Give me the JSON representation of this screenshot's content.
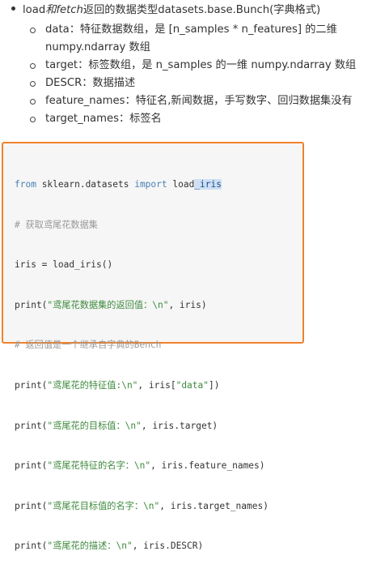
{
  "notes": {
    "top": {
      "prefix": "load",
      "italic": "和fetch",
      "suffix": "返回的数据类型datasets.base.Bunch(字典格式)"
    },
    "items": [
      "data：特征数据数组，是 [n_samples * n_features] 的二维",
      "numpy.ndarray 数组",
      "target：标签数组，是 n_samples 的一维 numpy.ndarray 数组",
      "DESCR：数据描述",
      "feature_names：特征名,新闻数据，手写数字、回归数据集没有",
      "target_names：标签名"
    ]
  },
  "code": {
    "l1_kw1": "from",
    "l1_mod": " sklearn.datasets ",
    "l1_kw2": "import",
    "l1_name_a": " load",
    "l1_name_sel": "_iris",
    "l2": "# 获取鸢尾花数据集",
    "l3": "iris = load_iris()",
    "l4_a": "print(",
    "l4_str": "\"鸢尾花数据集的返回值：\\n\"",
    "l4_b": ", iris)",
    "l5": "# 返回值是一个继承自字典的Bench",
    "l6_a": "print(",
    "l6_str": "\"鸢尾花的特征值:\\n\"",
    "l6_b": ", iris[",
    "l6_str2": "\"data\"",
    "l6_c": "])",
    "l7_a": "print(",
    "l7_str": "\"鸢尾花的目标值：\\n\"",
    "l7_b": ", iris.target)",
    "l8_a": "print(",
    "l8_str": "\"鸢尾花特征的名字：\\n\"",
    "l8_b": ", iris.feature_names)",
    "l9_a": "print(",
    "l9_str": "\"鸢尾花目标值的名字：\\n\"",
    "l9_b": ", iris.target_names)",
    "l10_a": "print(",
    "l10_str": "\"鸢尾花的描述：\\n\"",
    "l10_b": ", iris.DESCR)"
  },
  "colors": {
    "border": "#f0822c",
    "keyword": "#4a7fb5",
    "string": "#3d8a3d",
    "comment": "#999999"
  }
}
